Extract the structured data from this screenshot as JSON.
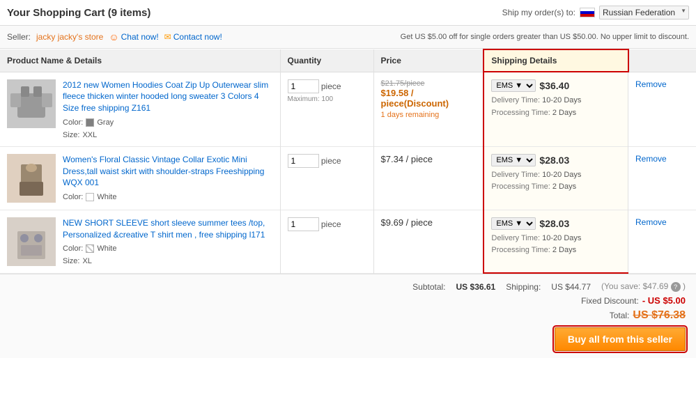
{
  "header": {
    "title": "Your Shopping Cart (9 items)",
    "ship_label": "Ship my order(s) to:",
    "country": "Russian Federation"
  },
  "seller": {
    "label": "Seller:",
    "name": "jacky jacky's store",
    "chat_label": "Chat now!",
    "contact_label": "Contact now!",
    "discount_notice": "Get US $5.00 off for single orders greater than US $50.00. No upper limit to discount."
  },
  "table": {
    "headers": {
      "product": "Product Name & Details",
      "quantity": "Quantity",
      "price": "Price",
      "shipping": "Shipping Details",
      "action": ""
    }
  },
  "items": [
    {
      "id": 1,
      "title": "2012 new Women Hoodies Coat Zip Up Outerwear slim fleece thicken winter hooded long sweater 3 Colors 4 Size free shipping Z161",
      "color_label": "Color:",
      "color": "Gray",
      "color_type": "gray",
      "size_label": "Size:",
      "size": "XXL",
      "quantity": "1",
      "qty_unit": "piece",
      "qty_max": "Maximum: 100",
      "original_price": "$21.75/piece",
      "discount_price": "$19.58 / piece(Discount)",
      "remaining": "1 days remaining",
      "shipping_method": "EMS",
      "shipping_price": "$36.40",
      "delivery_time": "10-20 Days",
      "processing_time": "2 Days",
      "action": "Remove"
    },
    {
      "id": 2,
      "title": "Women's Floral Classic Vintage Collar Exotic Mini Dress,tall waist skirt with shoulder-straps Freeshipping WQX 001",
      "color_label": "Color:",
      "color": "White",
      "color_type": "white",
      "size_label": null,
      "size": null,
      "quantity": "1",
      "qty_unit": "piece",
      "qty_max": null,
      "original_price": null,
      "discount_price": null,
      "regular_price": "$7.34 / piece",
      "remaining": null,
      "shipping_method": "EMS",
      "shipping_price": "$28.03",
      "delivery_time": "10-20 Days",
      "processing_time": "2 Days",
      "action": "Remove"
    },
    {
      "id": 3,
      "title": "NEW SHORT SLEEVE short sleeve summer tees /top, Personalized &creative T shirt men , free shipping l171",
      "color_label": "Color:",
      "color": "White",
      "color_type": "pattern",
      "size_label": "Size:",
      "size": "XL",
      "quantity": "1",
      "qty_unit": "piece",
      "qty_max": null,
      "original_price": null,
      "discount_price": null,
      "regular_price": "$9.69 / piece",
      "remaining": null,
      "shipping_method": "EMS",
      "shipping_price": "$28.03",
      "delivery_time": "10-20 Days",
      "processing_time": "2 Days",
      "action": "Remove"
    }
  ],
  "footer": {
    "subtotal_label": "Subtotal:",
    "subtotal_value": "US $36.61",
    "shipping_label": "Shipping:",
    "shipping_value": "US $44.77",
    "savings_label": "(You save: $47.69",
    "savings_close": ")",
    "fixed_discount_label": "Fixed Discount:",
    "fixed_discount_value": "- US $5.00",
    "total_label": "Total:",
    "total_value": "US $76.38",
    "buy_button": "Buy all from this seller"
  }
}
